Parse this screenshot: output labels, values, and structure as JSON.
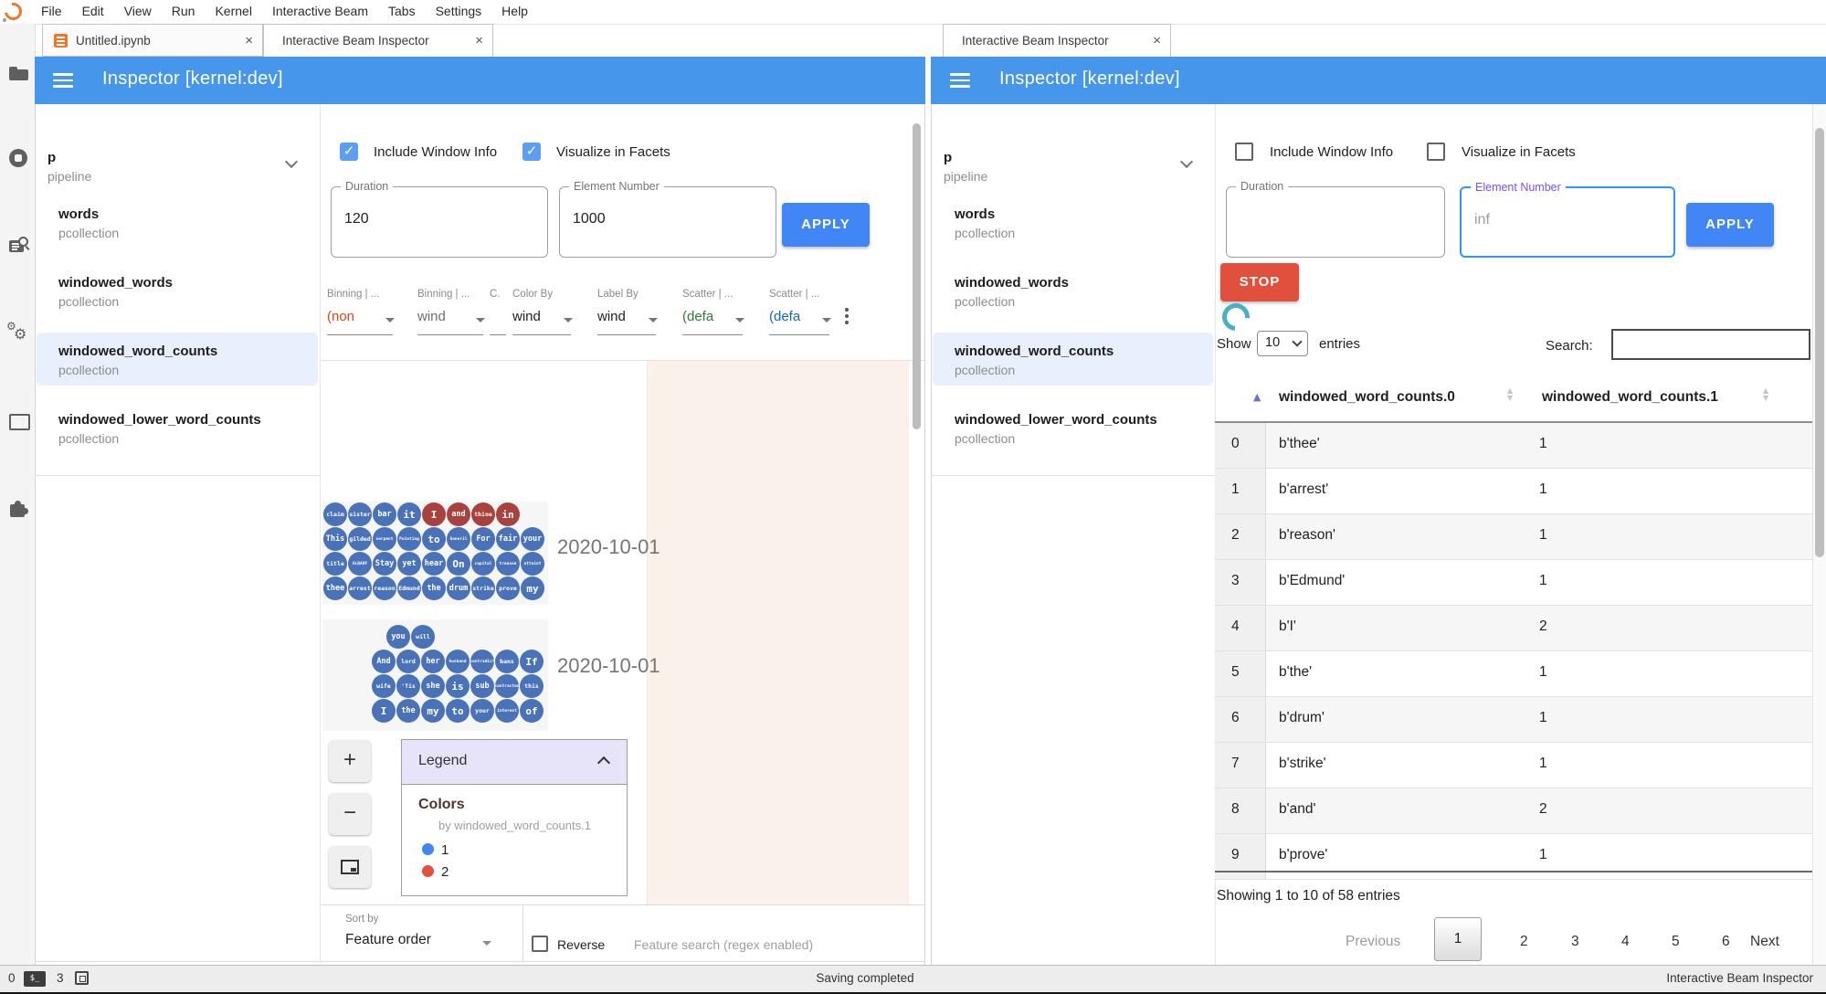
{
  "menubar": {
    "logo": "jupyter-logo",
    "items": [
      "File",
      "Edit",
      "View",
      "Run",
      "Kernel",
      "Interactive Beam",
      "Tabs",
      "Settings",
      "Help"
    ]
  },
  "sidebar": {
    "icons": [
      "file-browser-icon",
      "running-kernels-icon",
      "inspector-icon",
      "property-gears-icon",
      "open-tabs-icon",
      "extensions-puzzle-icon"
    ]
  },
  "tabbar": {
    "left_tabs": [
      {
        "label": "Untitled.ipynb",
        "close": "×",
        "active": false,
        "icon": "notebook-icon"
      },
      {
        "label": "Interactive Beam Inspector",
        "close": "×",
        "active": true
      }
    ],
    "right_tabs": [
      {
        "label": "Interactive Beam Inspector",
        "close": "×",
        "active": true
      }
    ]
  },
  "pipeline_tree": {
    "root_name": "p",
    "root_type": "pipeline",
    "items": [
      {
        "name": "words",
        "type": "pcollection",
        "selected": false
      },
      {
        "name": "windowed_words",
        "type": "pcollection",
        "selected": false
      },
      {
        "name": "windowed_word_counts",
        "type": "pcollection",
        "selected": true
      },
      {
        "name": "windowed_lower_word_counts",
        "type": "pcollection",
        "selected": false
      }
    ]
  },
  "inspector_left": {
    "title": "Inspector [kernel:dev]",
    "options": {
      "include_window_info": {
        "label": "Include Window Info",
        "checked": true
      },
      "visualize_in_facets": {
        "label": "Visualize in Facets",
        "checked": true
      }
    },
    "fields": {
      "duration": {
        "label": "Duration",
        "value": "120"
      },
      "element_number": {
        "label": "Element Number",
        "value": "1000"
      }
    },
    "apply_label": "APPLY",
    "facet_controls": [
      {
        "label": "Binning | ...",
        "value": "(non",
        "color": "#d9480f"
      },
      {
        "label": "Binning | ...",
        "value": "wind",
        "color": "#6f6f6f"
      },
      {
        "label": "C.",
        "value": "",
        "color": "#6f6f6f"
      },
      {
        "label": "Color By",
        "value": "wind",
        "color": "#212121"
      },
      {
        "label": "Label By",
        "value": "wind",
        "color": "#212121"
      },
      {
        "label": "Scatter | ...",
        "value": "(defa",
        "color": "#2e7d32"
      },
      {
        "label": "Scatter | ...",
        "value": "(defa",
        "color": "#1565c0"
      }
    ],
    "clusters": [
      {
        "date": "2020-10-01",
        "rows": [
          [
            [
              "claim",
              "sm",
              "b"
            ],
            [
              "sister",
              "sm",
              "b"
            ],
            [
              "bar",
              "md",
              "b"
            ],
            [
              "it",
              "lg",
              "b"
            ],
            [
              "I",
              "lg",
              "r"
            ],
            [
              "and",
              "md",
              "r"
            ],
            [
              "thine",
              "sm",
              "r"
            ],
            [
              "in",
              "lg",
              "r"
            ]
          ],
          [
            [
              "This",
              "md",
              "b"
            ],
            [
              "gilded",
              "sm",
              "b"
            ],
            [
              "serpent",
              "xs",
              "b"
            ],
            [
              "Pointing",
              "xs",
              "b"
            ],
            [
              "to",
              "lg",
              "b"
            ],
            [
              "Goneril",
              "xs",
              "b"
            ],
            [
              "For",
              "md",
              "b"
            ],
            [
              "fair",
              "md",
              "b"
            ],
            [
              "your",
              "md",
              "b"
            ]
          ],
          [
            [
              "title",
              "sm",
              "b"
            ],
            [
              "ALBANY",
              "xs",
              "b"
            ],
            [
              "Stay",
              "md",
              "b"
            ],
            [
              "yet",
              "md",
              "b"
            ],
            [
              "hear",
              "md",
              "b"
            ],
            [
              "On",
              "lg",
              "b"
            ],
            [
              "capital",
              "xs",
              "b"
            ],
            [
              "treason",
              "xs",
              "b"
            ],
            [
              "attaint",
              "xs",
              "b"
            ]
          ],
          [
            [
              "thee",
              "md",
              "b"
            ],
            [
              "arrest",
              "sm",
              "b"
            ],
            [
              "reason",
              "sm",
              "b"
            ],
            [
              "Edmund",
              "sm",
              "b"
            ],
            [
              "the",
              "md",
              "b"
            ],
            [
              "drum",
              "md",
              "b"
            ],
            [
              "strike",
              "sm",
              "b"
            ],
            [
              "prove",
              "sm",
              "b"
            ],
            [
              "my",
              "lg",
              "b"
            ]
          ]
        ]
      },
      {
        "date": "2020-10-01",
        "rows": [
          [
            [
              "you",
              "md",
              "b"
            ],
            [
              "will",
              "sm",
              "b"
            ]
          ],
          [
            [
              "And",
              "md",
              "b"
            ],
            [
              "lord",
              "sm",
              "b"
            ],
            [
              "her",
              "md",
              "b"
            ],
            [
              "husband",
              "xs",
              "b"
            ],
            [
              "contradict",
              "xs",
              "b"
            ],
            [
              "bans",
              "sm",
              "b"
            ],
            [
              "If",
              "lg",
              "b"
            ]
          ],
          [
            [
              "wife",
              "sm",
              "b"
            ],
            [
              "'Tis",
              "sm",
              "b"
            ],
            [
              "she",
              "md",
              "b"
            ],
            [
              "is",
              "lg",
              "b"
            ],
            [
              "sub",
              "md",
              "b"
            ],
            [
              "contracted",
              "xs",
              "b"
            ],
            [
              "this",
              "sm",
              "b"
            ]
          ],
          [
            [
              "I",
              "lg",
              "b"
            ],
            [
              "the",
              "md",
              "b"
            ],
            [
              "my",
              "lg",
              "b"
            ],
            [
              "to",
              "lg",
              "b"
            ],
            [
              "your",
              "sm",
              "b"
            ],
            [
              "interest",
              "xs",
              "b"
            ],
            [
              "of",
              "lg",
              "b"
            ]
          ]
        ]
      }
    ],
    "bubble_colors": {
      "blue": "#4a72b8",
      "red": "#a8423e"
    },
    "zoom_controls": {
      "zoom_in": "+",
      "zoom_out": "−"
    },
    "legend": {
      "title": "Legend",
      "section": "Colors",
      "subtitle": "by windowed_word_counts.1",
      "entries": [
        {
          "label": "1",
          "color": "#4285f4"
        },
        {
          "label": "2",
          "color": "#e25140"
        }
      ]
    },
    "sortbar": {
      "sort_by_label": "Sort by",
      "sort_value": "Feature order",
      "reverse_label": "Reverse",
      "search_placeholder": "Feature search (regex enabled)"
    }
  },
  "inspector_right": {
    "title": "Inspector [kernel:dev]",
    "options": {
      "include_window_info": {
        "label": "Include Window Info",
        "checked": false
      },
      "visualize_in_facets": {
        "label": "Visualize in Facets",
        "checked": false
      }
    },
    "fields": {
      "duration": {
        "label": "Duration",
        "value": ""
      },
      "element_number": {
        "label": "Element Number",
        "value": "inf",
        "focused": true
      }
    },
    "apply_label": "APPLY",
    "stop_label": "STOP",
    "table": {
      "show_label": "Show",
      "page_size": "10",
      "entries_label": "entries",
      "search_label": "Search:",
      "search_value": "",
      "columns": [
        "windowed_word_counts.0",
        "windowed_word_counts.1"
      ],
      "sorted_column_color": "#6673d6",
      "rows": [
        [
          "0",
          "b'thee'",
          "1"
        ],
        [
          "1",
          "b'arrest'",
          "1"
        ],
        [
          "2",
          "b'reason'",
          "1"
        ],
        [
          "3",
          "b'Edmund'",
          "1"
        ],
        [
          "4",
          "b'I'",
          "2"
        ],
        [
          "5",
          "b'the'",
          "1"
        ],
        [
          "6",
          "b'drum'",
          "1"
        ],
        [
          "7",
          "b'strike'",
          "1"
        ],
        [
          "8",
          "b'and'",
          "2"
        ],
        [
          "9",
          "b'prove'",
          "1"
        ]
      ],
      "summary": "Showing 1 to 10 of 58 entries",
      "prev_label": "Previous",
      "pages": [
        "1",
        "2",
        "3",
        "4",
        "5",
        "6"
      ],
      "active_page": "1",
      "next_label": "Next"
    }
  },
  "statusbar": {
    "terminal_count": "0",
    "kernel_count": "3",
    "message": "Saving completed",
    "context": "Interactive Beam Inspector"
  }
}
